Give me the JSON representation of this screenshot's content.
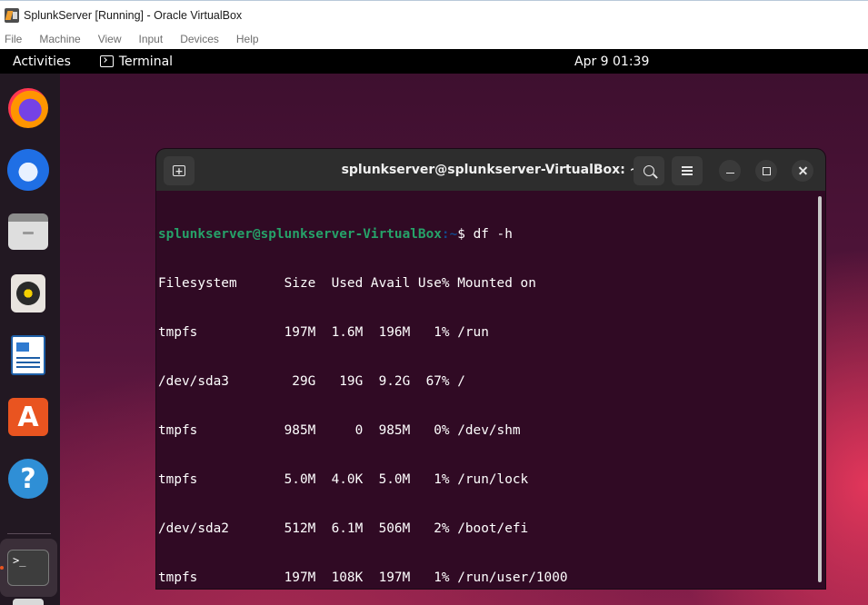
{
  "host": {
    "window_title": "SplunkServer [Running] - Oracle VirtualBox",
    "menu": [
      "File",
      "Machine",
      "View",
      "Input",
      "Devices",
      "Help"
    ]
  },
  "topbar": {
    "activities": "Activities",
    "app_name": "Terminal",
    "clock": "Apr 9  01:39"
  },
  "dock": {
    "items": [
      {
        "name": "firefox-icon",
        "glyph": ""
      },
      {
        "name": "thunderbird-icon",
        "glyph": ""
      },
      {
        "name": "files-icon",
        "glyph": ""
      },
      {
        "name": "rhythmbox-icon",
        "glyph": ""
      },
      {
        "name": "libreoffice-writer-icon",
        "glyph": ""
      },
      {
        "name": "app-center-icon",
        "glyph": "A"
      },
      {
        "name": "help-icon",
        "glyph": "?"
      },
      {
        "name": "terminal-icon",
        "glyph": ">_"
      },
      {
        "name": "trash-icon",
        "glyph": ""
      }
    ],
    "accent": "#e9541f"
  },
  "terminal": {
    "title": "splunkserver@splunkserver-VirtualBox: ~",
    "prompt_user": "splunkserver@splunkserver-VirtualBox",
    "prompt_path": ":~",
    "prompt_symbol": "$ ",
    "command": "df -h",
    "header": "Filesystem      Size  Used Avail Use% Mounted on",
    "rows": [
      "tmpfs           197M  1.6M  196M   1% /run",
      "/dev/sda3        29G   19G  9.2G  67% /",
      "tmpfs           985M     0  985M   0% /dev/shm",
      "tmpfs           5.0M  4.0K  5.0M   1% /run/lock",
      "/dev/sda2       512M  6.1M  506M   2% /boot/efi",
      "tmpfs           197M  108K  197M   1% /run/user/1000"
    ],
    "prompt2_symbol": "$",
    "colors": {
      "user": "#26a269",
      "path": "#12488b",
      "background": "#300a24"
    }
  }
}
